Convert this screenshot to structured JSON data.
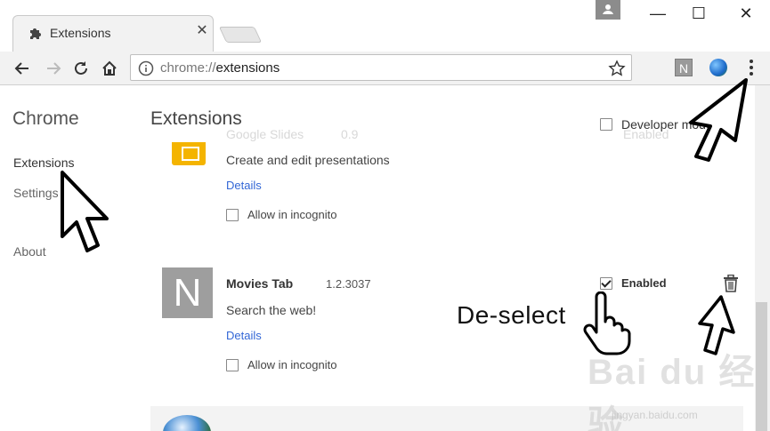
{
  "tab": {
    "title": "Extensions",
    "close": "✕"
  },
  "window": {
    "minimize": "—",
    "maximize": "☐",
    "close": "✕"
  },
  "omnibox": {
    "scheme": "chrome://",
    "path": "extensions"
  },
  "toolbar_ext": {
    "n_label": "N"
  },
  "sidebar": {
    "title": "Chrome",
    "items": [
      {
        "label": "Extensions"
      },
      {
        "label": "Settings"
      },
      {
        "label": "About"
      }
    ]
  },
  "main": {
    "title": "Extensions",
    "developer_mode": "Developer mode",
    "extensions": [
      {
        "name": "Google Slides",
        "version": "0.9",
        "enabled_ghost": "Enabled",
        "description": "Create and edit presentations",
        "details": "Details",
        "incognito": "Allow in incognito"
      },
      {
        "name": "Movies Tab",
        "icon_letter": "N",
        "version": "1.2.3037",
        "enabled_label": "Enabled",
        "description": "Search the web!",
        "details": "Details",
        "incognito": "Allow in incognito"
      }
    ]
  },
  "annotation": {
    "text": "De-select"
  },
  "watermark": {
    "brand": "Bai du 经验",
    "url": "jingyan.baidu.com"
  },
  "colors": {
    "link": "#3367d6",
    "slides": "#f4b400",
    "icon_grey": "#9e9e9e"
  }
}
